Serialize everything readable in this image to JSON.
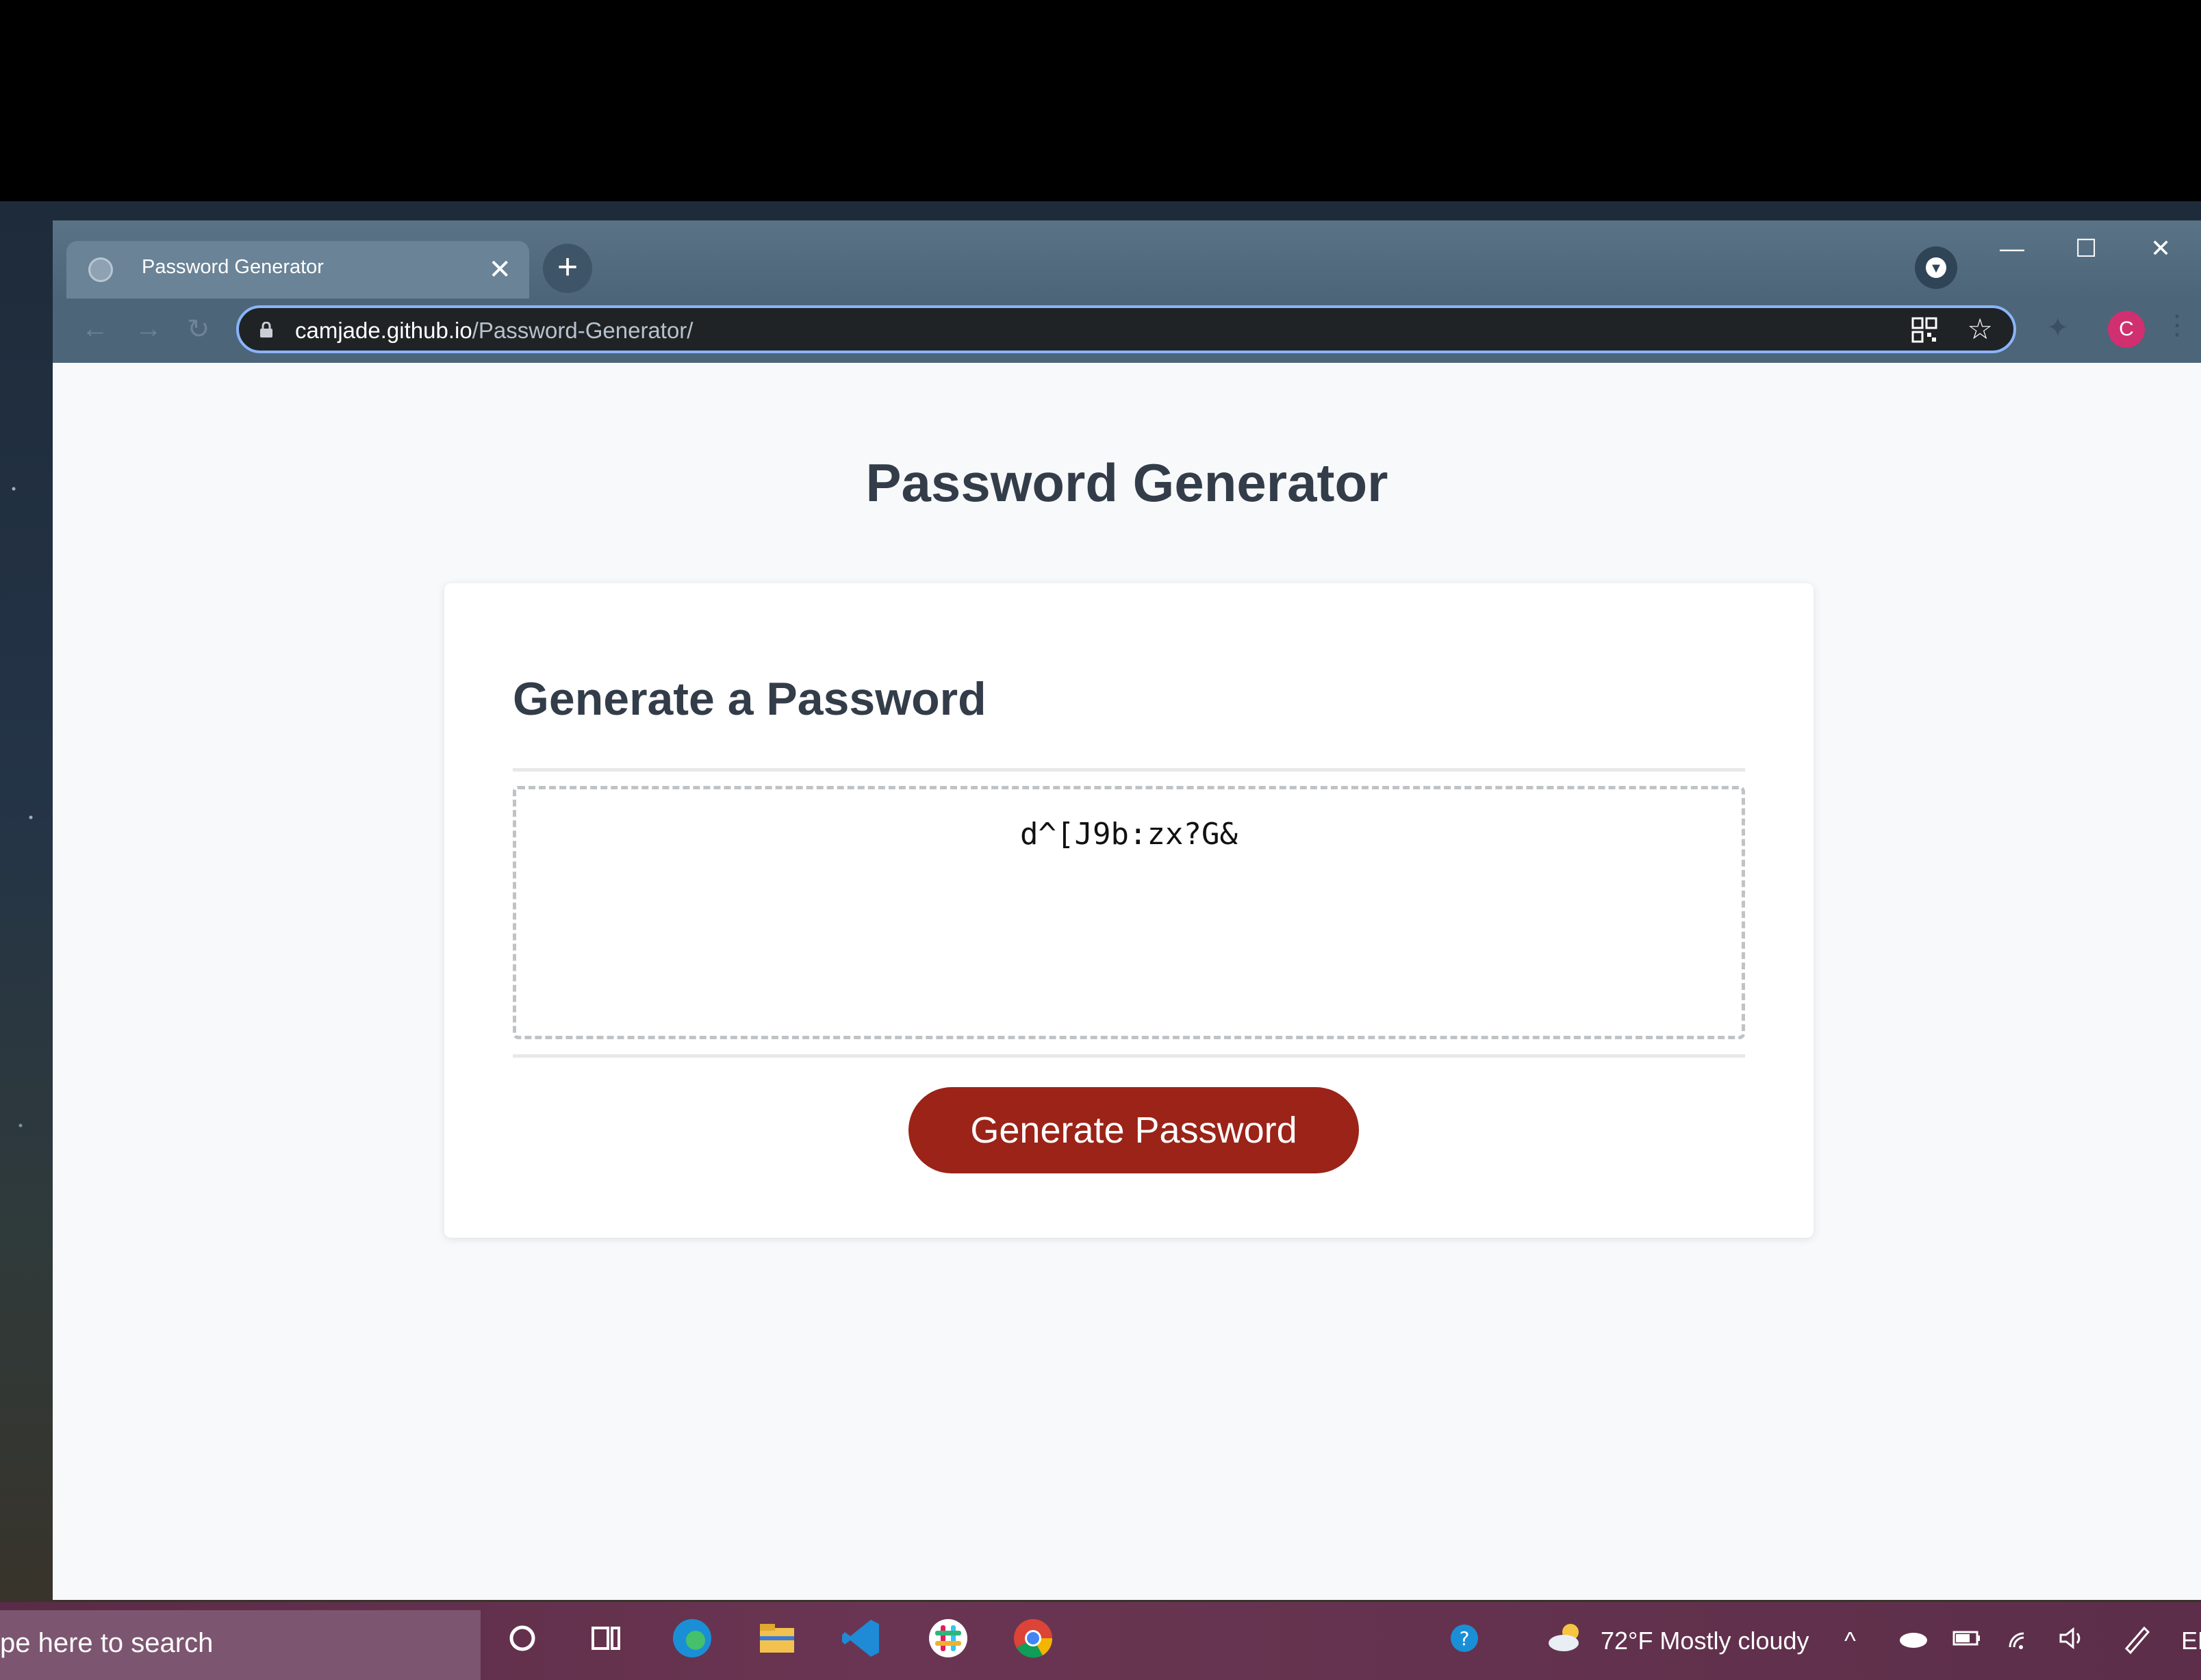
{
  "browser": {
    "tab_title": "Password Generator",
    "tab_close": "✕",
    "new_tab": "+",
    "url_host": "camjade.github.io",
    "url_path": "/Password-Generator/",
    "avatar_letter": "C",
    "window_controls": [
      "—",
      "☐",
      "✕"
    ]
  },
  "page": {
    "title": "Password Generator",
    "card_header": "Generate a Password",
    "password": "d^[J9b:zx?G&",
    "button_label": "Generate Password"
  },
  "taskbar": {
    "search_placeholder": "pe here to search",
    "weather": "72°F  Mostly cloudy",
    "lang": "EN"
  },
  "colors": {
    "button": "#9b2318",
    "heading": "#333d49",
    "titlebar": "#4c6579"
  }
}
